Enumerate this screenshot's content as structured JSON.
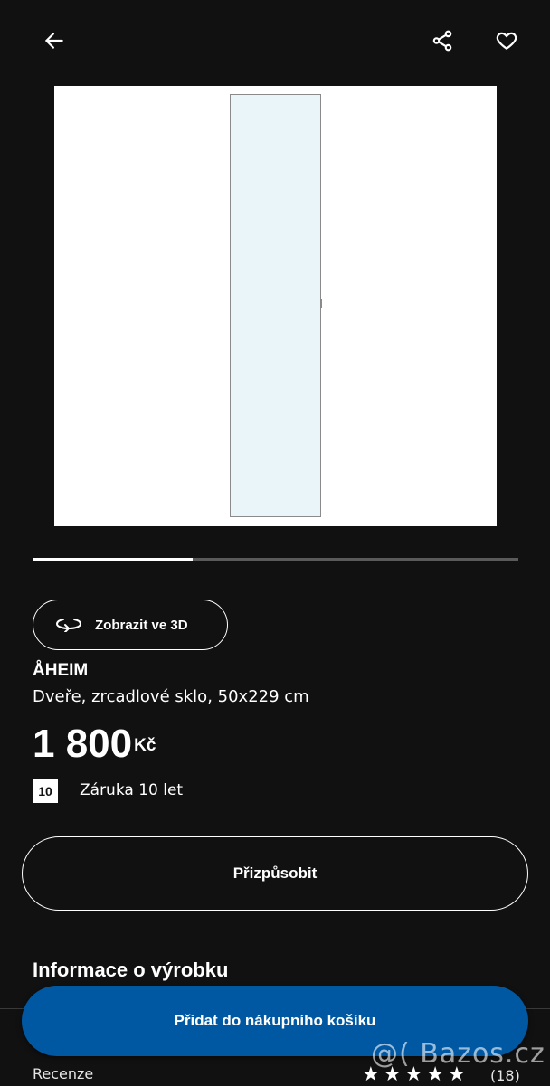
{
  "colors": {
    "background": "#111111",
    "accent": "#0058a3",
    "text": "#ffffff"
  },
  "header": {
    "back_icon": "arrow-left-icon",
    "share_icon": "share-icon",
    "favorite_icon": "heart-outline-icon"
  },
  "gallery": {
    "progress_fraction": 0.33
  },
  "view3d": {
    "label": "Zobrazit ve 3D",
    "icon": "rotate-3d-icon"
  },
  "product": {
    "name": "ÅHEIM",
    "description": "Dveře, zrcadlové sklo, 50x229 cm",
    "price": "1 800",
    "currency": "Kč"
  },
  "warranty": {
    "badge": "10",
    "text": "Záruka 10 let"
  },
  "customize": {
    "label": "Přizpůsobit"
  },
  "info": {
    "heading": "Informace o výrobku"
  },
  "reviews": {
    "label": "Recenze",
    "rating": 5,
    "count": "(18)"
  },
  "cart": {
    "label": "Přidat do nákupního košíku"
  },
  "watermark": {
    "text": "@( Bazos.cz"
  }
}
